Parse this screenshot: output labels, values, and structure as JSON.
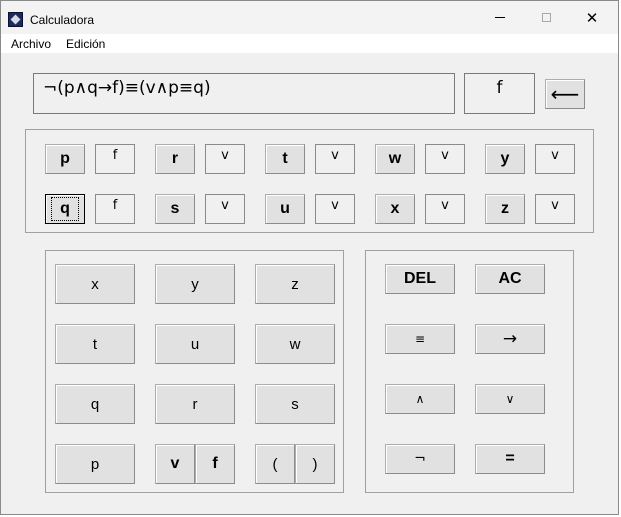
{
  "window": {
    "title": "Calculadora",
    "minimize_glyph": "",
    "maximize_glyph": "",
    "close_glyph": "✕"
  },
  "menu": [
    "Archivo",
    "Edición"
  ],
  "display": {
    "expression": "¬(p∧q→f)≡(v∧p≡q)",
    "result": "f",
    "backspace_glyph": "⟵"
  },
  "variables": [
    {
      "name": "p",
      "value": "f"
    },
    {
      "name": "r",
      "value": "v"
    },
    {
      "name": "t",
      "value": "v"
    },
    {
      "name": "w",
      "value": "v"
    },
    {
      "name": "y",
      "value": "v"
    },
    {
      "name": "q",
      "value": "f"
    },
    {
      "name": "s",
      "value": "v"
    },
    {
      "name": "u",
      "value": "v"
    },
    {
      "name": "x",
      "value": "v"
    },
    {
      "name": "z",
      "value": "v"
    }
  ],
  "keypad": {
    "x": "x",
    "y": "y",
    "z": "z",
    "t": "t",
    "u": "u",
    "w": "w",
    "q": "q",
    "r": "r",
    "s": "s",
    "p": "p",
    "v": "v",
    "f": "f",
    "open_paren": "(",
    "close_paren": ")"
  },
  "operators": {
    "del": "DEL",
    "ac": "AC",
    "equiv": "≡",
    "implies": "→",
    "and": "∧",
    "or": "∨",
    "not": "¬",
    "equals": "="
  }
}
